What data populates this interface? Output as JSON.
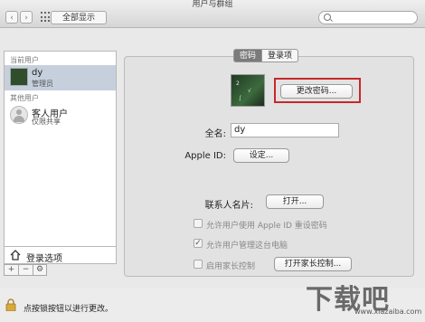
{
  "window": {
    "title": "用户与群组"
  },
  "toolbar": {
    "back": "‹",
    "forward": "›",
    "show_all_label": "全部显示",
    "search_placeholder": ""
  },
  "sidebar": {
    "current_users_label": "当前用户",
    "current_user": {
      "name": "dy",
      "role": "管理员"
    },
    "other_users_label": "其他用户",
    "guest_user": {
      "name": "客人用户",
      "role": "仅限共享"
    },
    "login_options_label": "登录选项",
    "tools": {
      "add": "+",
      "remove": "−",
      "action": "⚙"
    }
  },
  "tabs": [
    {
      "label": "密码",
      "active": true
    },
    {
      "label": "登录项",
      "active": false
    }
  ],
  "picture_label": "",
  "change_password_label": "更改密码...",
  "full_name": {
    "label": "全名:",
    "value": "dy"
  },
  "apple_id": {
    "label": "Apple ID:",
    "button": "设定..."
  },
  "contact_card": {
    "label": "联系人名片:",
    "button": "打开..."
  },
  "checks": {
    "allow_apple_id_reset": {
      "label": "允许用户使用 Apple ID 重设密码",
      "checked": false
    },
    "allow_admin": {
      "label": "允许用户管理这台电脑",
      "checked": true
    },
    "parental": {
      "label": "启用家长控制",
      "checked": false,
      "button": "打开家长控制..."
    }
  },
  "footer": {
    "lock_text": "点按锁按钮以进行更改。"
  },
  "watermark": {
    "logo": "下载吧",
    "url": "www.xiazaiba.com"
  },
  "colors": {
    "highlight": "#c8282a",
    "selection": "#c6d0dd"
  }
}
